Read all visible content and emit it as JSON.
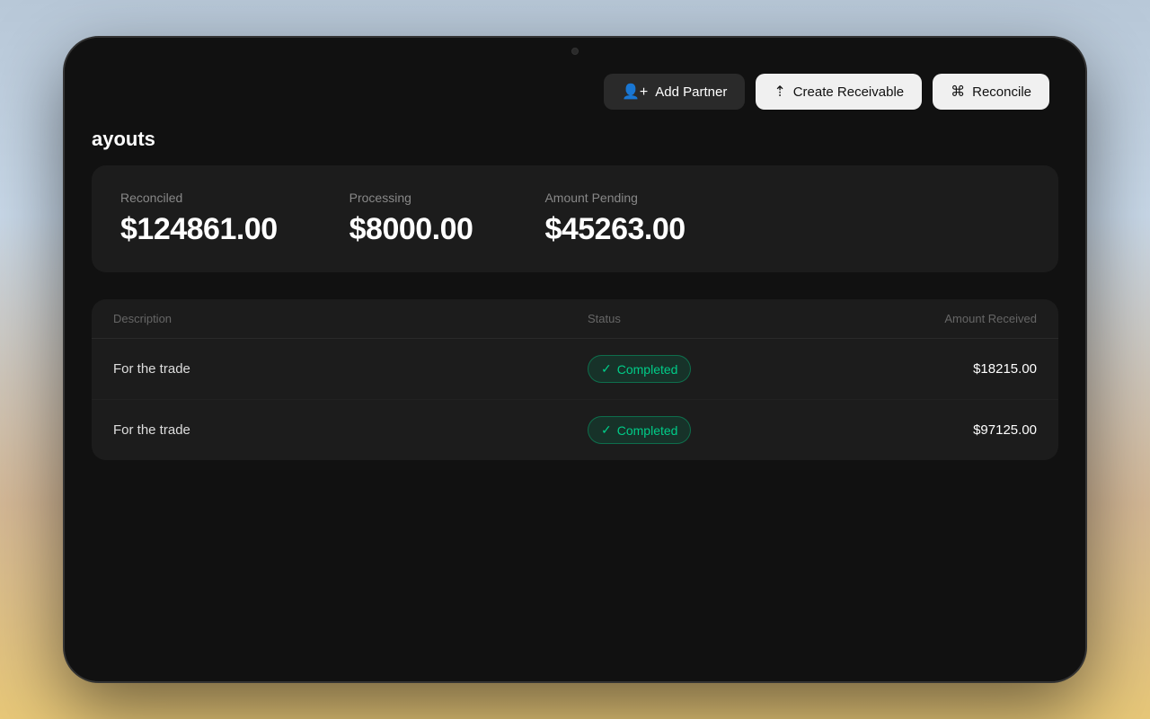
{
  "device": {
    "camera_label": "camera"
  },
  "header": {
    "buttons": {
      "add_partner": "Add Partner",
      "create_receivable": "Create Receivable",
      "reconcile": "Reconcile"
    }
  },
  "section": {
    "title": "ayouts"
  },
  "stats": {
    "reconciled": {
      "label": "Reconciled",
      "value": "$124861.00"
    },
    "processing": {
      "label": "Processing",
      "value": "$8000.00"
    },
    "amount_pending": {
      "label": "Amount Pending",
      "value": "$45263.00"
    }
  },
  "table": {
    "columns": {
      "description": "Description",
      "status": "Status",
      "amount_received": "Amount Received"
    },
    "rows": [
      {
        "description": "For the trade",
        "status": "Completed",
        "amount": "$18215.00"
      },
      {
        "description": "For the trade",
        "status": "Completed",
        "amount": "$97125.00"
      }
    ]
  }
}
